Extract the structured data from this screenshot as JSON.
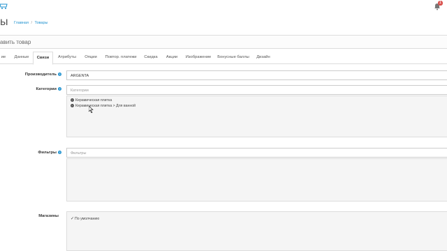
{
  "header": {
    "logo_icon": "shopping-cart-icon",
    "alert_icon": "bell-icon",
    "alert_count": "1"
  },
  "page": {
    "title": "ы",
    "breadcrumb": [
      "Главная",
      "Товары"
    ]
  },
  "panel": {
    "heading": "авить товар"
  },
  "tabs": [
    "ие",
    "Данные",
    "Связи",
    "Атрибуты",
    "Опции",
    "Повтор. платежи",
    "Скидка",
    "Акции",
    "Изображение",
    "Бонусные баллы",
    "Дизайн"
  ],
  "active_tab": "Связи",
  "form": {
    "manufacturer": {
      "label": "Производитель",
      "value": "ARGENTA"
    },
    "categories": {
      "label": "Категории",
      "placeholder": "Категории",
      "items": [
        "Керамическая плитка",
        "Керамическая плитка > Для ванной"
      ]
    },
    "filters": {
      "label": "Фильтры",
      "placeholder": "Фильтры"
    },
    "stores": {
      "label": "Магазины",
      "items": [
        {
          "label": "По умолчанию",
          "checked": true
        }
      ]
    }
  },
  "colors": {
    "accent": "#1e91cf",
    "badge": "#d9534f"
  }
}
